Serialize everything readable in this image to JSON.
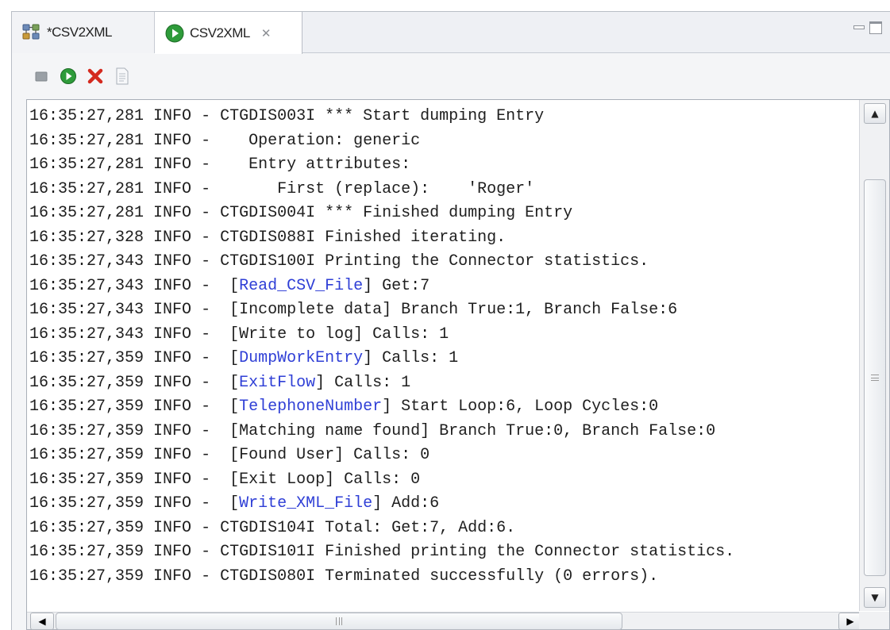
{
  "tabs": [
    {
      "label": "*CSV2XML",
      "icon": "assembly-line-icon",
      "active": false
    },
    {
      "label": "CSV2XML",
      "icon": "run-icon",
      "active": true,
      "close_icon": "close-tab-icon"
    }
  ],
  "toolbar": {
    "buttons": [
      {
        "icon": "stop-icon"
      },
      {
        "icon": "run-icon"
      },
      {
        "icon": "clear-icon"
      },
      {
        "icon": "document-icon"
      }
    ]
  },
  "colors": {
    "link": "#2f3fd6",
    "run_green": "#2e9b3a",
    "clear_red": "#d42a1f"
  },
  "log": {
    "lines": [
      {
        "ts": "16:35:27,281",
        "level": "INFO",
        "pre": " - CTGDIS003I *** Start dumping Entry",
        "link": "",
        "post": ""
      },
      {
        "ts": "16:35:27,281",
        "level": "INFO",
        "pre": " -    Operation: generic",
        "link": "",
        "post": ""
      },
      {
        "ts": "16:35:27,281",
        "level": "INFO",
        "pre": " -    Entry attributes:",
        "link": "",
        "post": ""
      },
      {
        "ts": "16:35:27,281",
        "level": "INFO",
        "pre": " -       First (replace):    'Roger'",
        "link": "",
        "post": ""
      },
      {
        "ts": "16:35:27,281",
        "level": "INFO",
        "pre": " - CTGDIS004I *** Finished dumping Entry",
        "link": "",
        "post": ""
      },
      {
        "ts": "16:35:27,328",
        "level": "INFO",
        "pre": " - CTGDIS088I Finished iterating.",
        "link": "",
        "post": ""
      },
      {
        "ts": "16:35:27,343",
        "level": "INFO",
        "pre": " - CTGDIS100I Printing the Connector statistics.",
        "link": "",
        "post": ""
      },
      {
        "ts": "16:35:27,343",
        "level": "INFO",
        "pre": " -  [",
        "link": "Read_CSV_File",
        "post": "] Get:7"
      },
      {
        "ts": "16:35:27,343",
        "level": "INFO",
        "pre": " -  [Incomplete data] Branch True:1, Branch False:6",
        "link": "",
        "post": ""
      },
      {
        "ts": "16:35:27,343",
        "level": "INFO",
        "pre": " -  [Write to log] Calls: 1",
        "link": "",
        "post": ""
      },
      {
        "ts": "16:35:27,359",
        "level": "INFO",
        "pre": " -  [",
        "link": "DumpWorkEntry",
        "post": "] Calls: 1"
      },
      {
        "ts": "16:35:27,359",
        "level": "INFO",
        "pre": " -  [",
        "link": "ExitFlow",
        "post": "] Calls: 1"
      },
      {
        "ts": "16:35:27,359",
        "level": "INFO",
        "pre": " -  [",
        "link": "TelephoneNumber",
        "post": "] Start Loop:6, Loop Cycles:0"
      },
      {
        "ts": "16:35:27,359",
        "level": "INFO",
        "pre": " -  [Matching name found] Branch True:0, Branch False:0",
        "link": "",
        "post": ""
      },
      {
        "ts": "16:35:27,359",
        "level": "INFO",
        "pre": " -  [Found User] Calls: 0",
        "link": "",
        "post": ""
      },
      {
        "ts": "16:35:27,359",
        "level": "INFO",
        "pre": " -  [Exit Loop] Calls: 0",
        "link": "",
        "post": ""
      },
      {
        "ts": "16:35:27,359",
        "level": "INFO",
        "pre": " -  [",
        "link": "Write_XML_File",
        "post": "] Add:6"
      },
      {
        "ts": "16:35:27,359",
        "level": "INFO",
        "pre": " - CTGDIS104I Total: Get:7, Add:6.",
        "link": "",
        "post": ""
      },
      {
        "ts": "16:35:27,359",
        "level": "INFO",
        "pre": " - CTGDIS101I Finished printing the Connector statistics.",
        "link": "",
        "post": ""
      },
      {
        "ts": "16:35:27,359",
        "level": "INFO",
        "pre": " - CTGDIS080I Terminated successfully (0 errors).",
        "link": "",
        "post": ""
      }
    ]
  },
  "scrollbars": {
    "vertical": {
      "up_icon": "scroll-up-icon",
      "down_icon": "scroll-down-icon"
    },
    "horizontal": {
      "left_icon": "scroll-left-icon",
      "right_icon": "scroll-right-icon"
    }
  }
}
